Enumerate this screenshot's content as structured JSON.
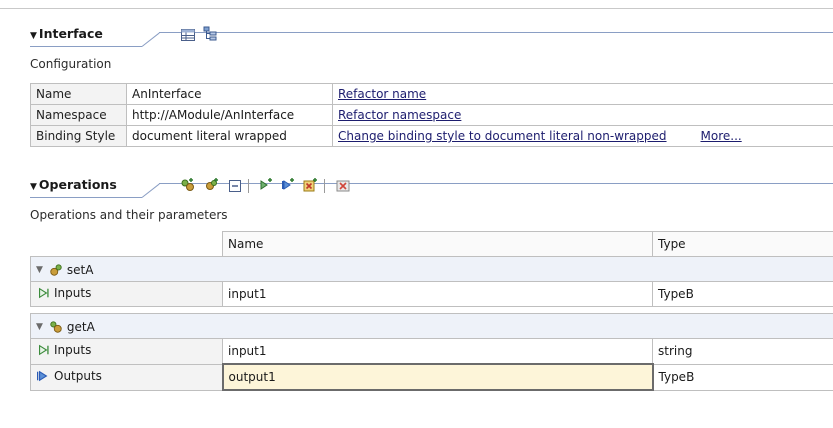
{
  "interface_section": {
    "title": "Interface",
    "caption": "Configuration",
    "toolbar_icons": [
      "table-view-icon",
      "tree-view-icon"
    ],
    "rows": [
      {
        "label": "Name",
        "value": "AnInterface",
        "action": "Refactor name",
        "extra": ""
      },
      {
        "label": "Namespace",
        "value": "http://AModule/AnInterface",
        "action": "Refactor namespace",
        "extra": ""
      },
      {
        "label": "Binding Style",
        "value": "document literal wrapped",
        "action": "Change binding style to document literal non-wrapped",
        "extra": "More..."
      }
    ]
  },
  "operations_section": {
    "title": "Operations",
    "caption": "Operations and their parameters",
    "toolbar_icons": [
      "add-request-response-operation-icon",
      "add-one-way-operation-icon",
      "collapse-all-icon",
      "add-input-icon",
      "add-output-icon",
      "add-fault-icon",
      "delete-icon"
    ],
    "columns": {
      "name": "Name",
      "type": "Type"
    },
    "operations": [
      {
        "name": "setA",
        "params": [
          {
            "kind": "Inputs",
            "name": "input1",
            "type": "TypeB"
          }
        ]
      },
      {
        "name": "getA",
        "params": [
          {
            "kind": "Inputs",
            "name": "input1",
            "type": "string"
          },
          {
            "kind": "Outputs",
            "name": "output1",
            "type": "TypeB"
          }
        ]
      }
    ]
  },
  "colors": {
    "header_line": "#8a9ec4",
    "link": "#1d1d6e",
    "editing_cell": "#fdf5d9",
    "input_arrow": "#3a8a3a",
    "output_arrow": "#2a5bb5"
  }
}
